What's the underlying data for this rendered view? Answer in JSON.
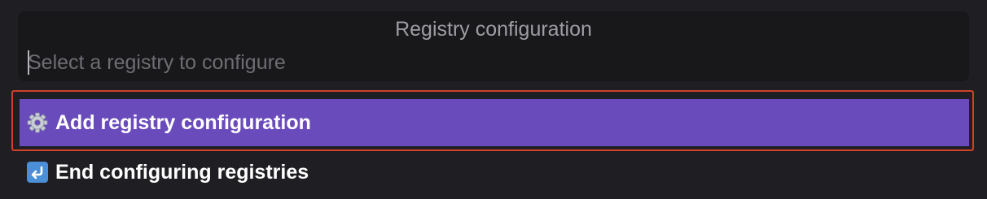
{
  "palette": {
    "title": "Registry configuration",
    "search_placeholder": "Select a registry to configure",
    "items": [
      {
        "icon": "gear-icon",
        "label": "Add registry configuration",
        "selected": true
      },
      {
        "icon": "return-arrow-icon",
        "label": "End configuring registries",
        "selected": false
      }
    ]
  },
  "colors": {
    "background": "#1f1f23",
    "selected_item": "#6a4bbb",
    "focus_ring": "#d0412a",
    "return_icon": "#4b8fd8"
  }
}
